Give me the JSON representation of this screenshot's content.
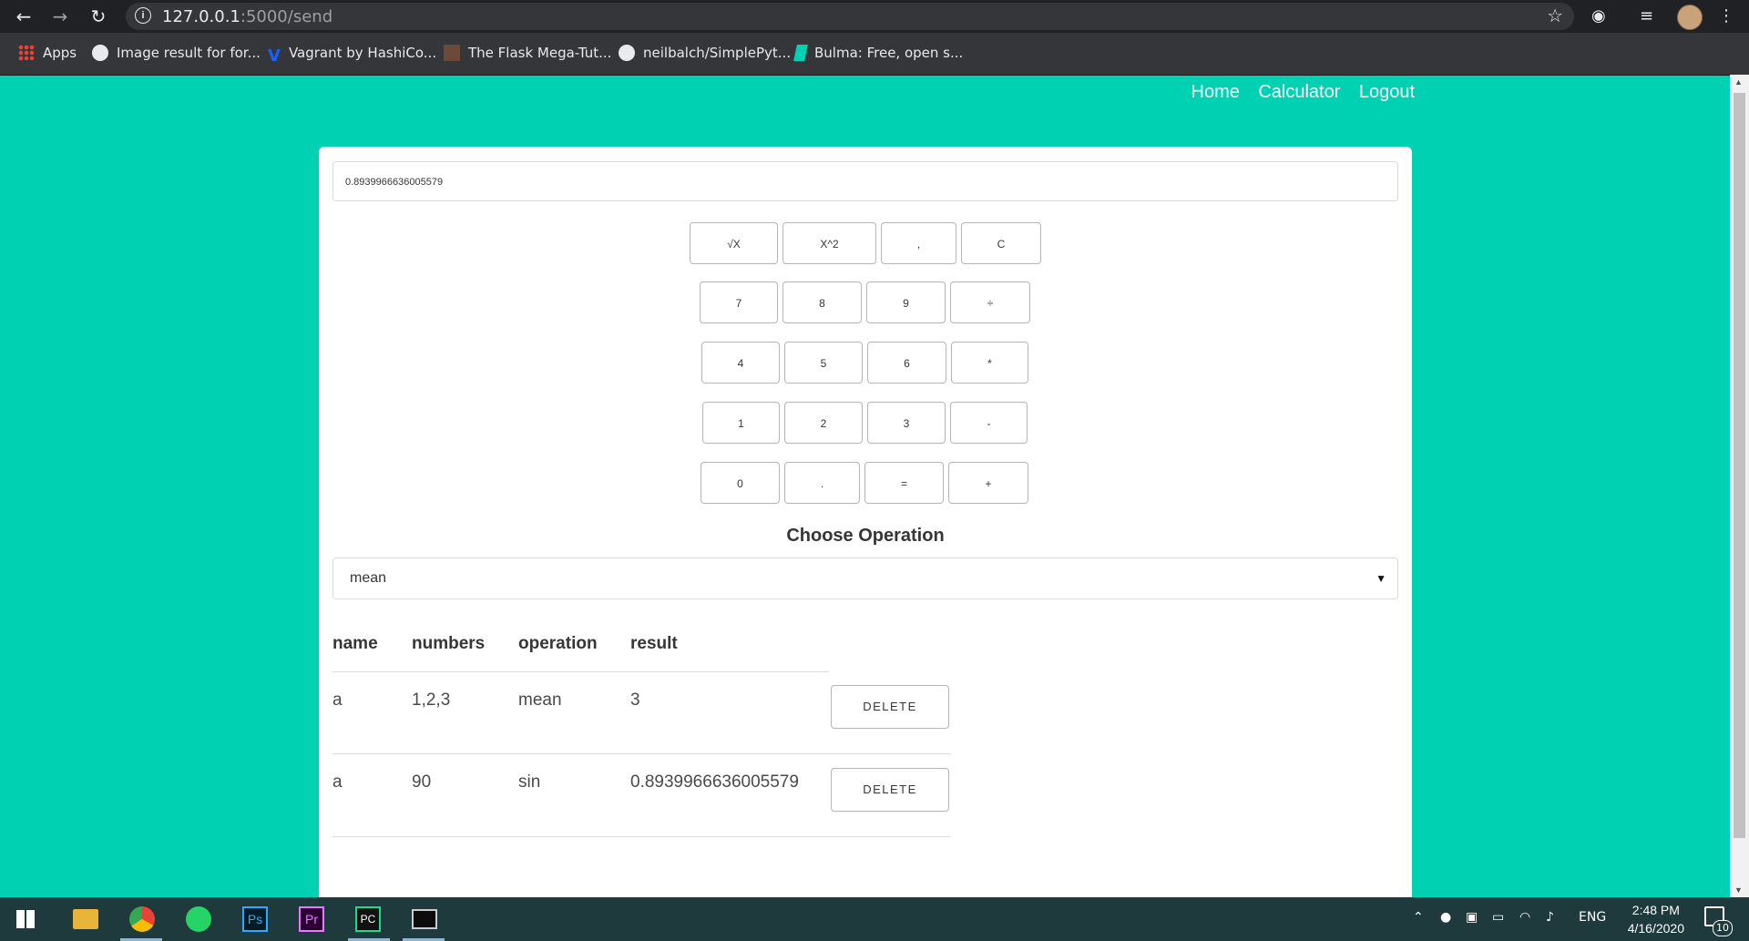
{
  "browser": {
    "url_host": "127.0.0.1",
    "url_path": ":5000/send",
    "bookmarks": [
      "Apps",
      "Image result for for...",
      "Vagrant by HashiCo...",
      "The Flask Mega-Tut...",
      "neilbalch/SimplePyt...",
      "Bulma: Free, open s..."
    ]
  },
  "nav": {
    "home": "Home",
    "calculator": "Calculator",
    "logout": "Logout"
  },
  "calculator": {
    "display": "0.8939966636005579",
    "keys": [
      "√X",
      "X^2",
      ",",
      "C",
      "7",
      "8",
      "9",
      "÷",
      "4",
      "5",
      "6",
      "*",
      "1",
      "2",
      "3",
      "-",
      "0",
      ".",
      "=",
      "+"
    ]
  },
  "operation": {
    "heading": "Choose Operation",
    "selected": "mean"
  },
  "table": {
    "headers": [
      "name",
      "numbers",
      "operation",
      "result"
    ],
    "rows": [
      {
        "name": "a",
        "numbers": "1,2,3",
        "operation": "mean",
        "result": "3"
      },
      {
        "name": "a",
        "numbers": "90",
        "operation": "sin",
        "result": "0.8939966636005579"
      }
    ],
    "delete_label": "DELETE"
  },
  "taskbar": {
    "lang": "ENG",
    "time": "2:48 PM",
    "date": "4/16/2020",
    "notifications": "10"
  }
}
